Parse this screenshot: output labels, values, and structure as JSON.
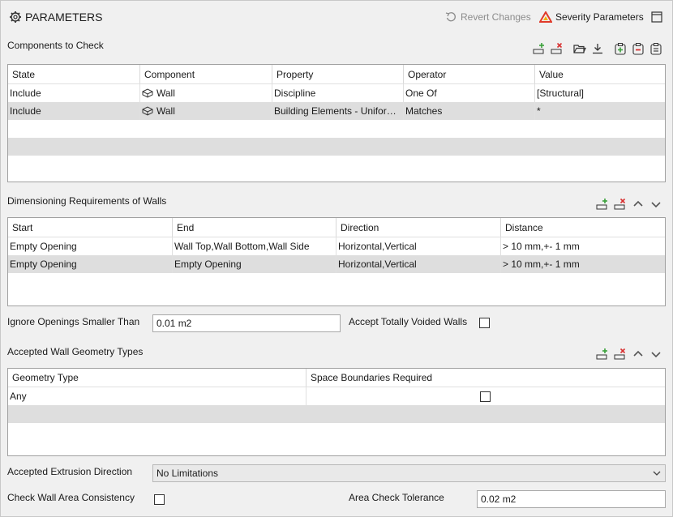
{
  "header": {
    "title": "PARAMETERS",
    "revert_label": "Revert Changes",
    "severity_label": "Severity Parameters"
  },
  "components": {
    "label": "Components to Check",
    "columns": [
      "State",
      "Component",
      "Property",
      "Operator",
      "Value"
    ],
    "rows": [
      {
        "state": "Include",
        "component": "Wall",
        "property": "Discipline",
        "operator": "One Of",
        "value": "[Structural]"
      },
      {
        "state": "Include",
        "component": "Wall",
        "property": "Building Elements - Unifor…",
        "operator": "Matches",
        "value": "*"
      }
    ]
  },
  "dimensioning": {
    "label": "Dimensioning Requirements of Walls",
    "columns": [
      "Start",
      "End",
      "Direction",
      "Distance"
    ],
    "rows": [
      {
        "start": "Empty Opening",
        "end": "Wall Top,Wall Bottom,Wall Side",
        "direction": "Horizontal,Vertical",
        "distance": "> 10 mm,+- 1 mm"
      },
      {
        "start": "Empty Opening",
        "end": "Empty Opening",
        "direction": "Horizontal,Vertical",
        "distance": "> 10 mm,+- 1 mm"
      }
    ]
  },
  "ignore_openings": {
    "label": "Ignore Openings Smaller Than",
    "value": "0.01 m2"
  },
  "accept_voided": {
    "label": "Accept Totally Voided Walls",
    "checked": false
  },
  "geometry": {
    "label": "Accepted Wall Geometry Types",
    "columns": [
      "Geometry Type",
      "Space Boundaries Required"
    ],
    "rows": [
      {
        "type": "Any",
        "space_boundaries_required": false
      }
    ]
  },
  "extrusion": {
    "label": "Accepted Extrusion Direction",
    "value": "No Limitations"
  },
  "area_consistency": {
    "label": "Check Wall Area Consistency",
    "checked": false
  },
  "area_tolerance": {
    "label": "Area Check Tolerance",
    "value": "0.02 m2"
  },
  "colors": {
    "add_icon": "#3aa13a",
    "remove_icon": "#d83030",
    "severity_red": "#e03a2a",
    "severity_yellow": "#f2b20a",
    "selected_row": "#dedede"
  }
}
